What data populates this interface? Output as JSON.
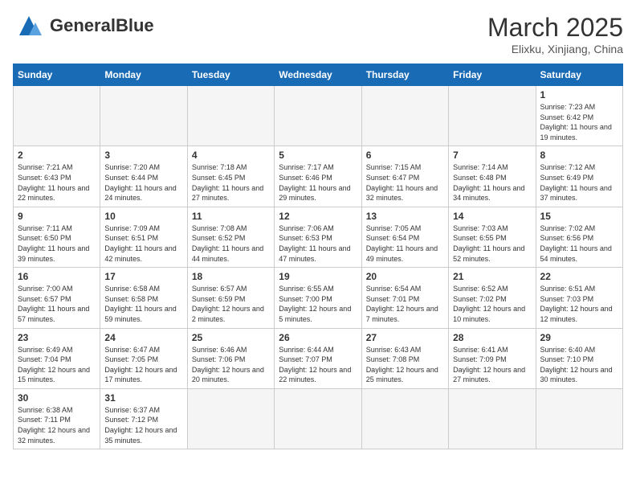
{
  "logo": {
    "text_normal": "General",
    "text_bold": "Blue"
  },
  "title": "March 2025",
  "location": "Elixku, Xinjiang, China",
  "days_of_week": [
    "Sunday",
    "Monday",
    "Tuesday",
    "Wednesday",
    "Thursday",
    "Friday",
    "Saturday"
  ],
  "weeks": [
    [
      {
        "num": "",
        "info": ""
      },
      {
        "num": "",
        "info": ""
      },
      {
        "num": "",
        "info": ""
      },
      {
        "num": "",
        "info": ""
      },
      {
        "num": "",
        "info": ""
      },
      {
        "num": "",
        "info": ""
      },
      {
        "num": "1",
        "info": "Sunrise: 7:23 AM\nSunset: 6:42 PM\nDaylight: 11 hours and 19 minutes."
      }
    ],
    [
      {
        "num": "2",
        "info": "Sunrise: 7:21 AM\nSunset: 6:43 PM\nDaylight: 11 hours and 22 minutes."
      },
      {
        "num": "3",
        "info": "Sunrise: 7:20 AM\nSunset: 6:44 PM\nDaylight: 11 hours and 24 minutes."
      },
      {
        "num": "4",
        "info": "Sunrise: 7:18 AM\nSunset: 6:45 PM\nDaylight: 11 hours and 27 minutes."
      },
      {
        "num": "5",
        "info": "Sunrise: 7:17 AM\nSunset: 6:46 PM\nDaylight: 11 hours and 29 minutes."
      },
      {
        "num": "6",
        "info": "Sunrise: 7:15 AM\nSunset: 6:47 PM\nDaylight: 11 hours and 32 minutes."
      },
      {
        "num": "7",
        "info": "Sunrise: 7:14 AM\nSunset: 6:48 PM\nDaylight: 11 hours and 34 minutes."
      },
      {
        "num": "8",
        "info": "Sunrise: 7:12 AM\nSunset: 6:49 PM\nDaylight: 11 hours and 37 minutes."
      }
    ],
    [
      {
        "num": "9",
        "info": "Sunrise: 7:11 AM\nSunset: 6:50 PM\nDaylight: 11 hours and 39 minutes."
      },
      {
        "num": "10",
        "info": "Sunrise: 7:09 AM\nSunset: 6:51 PM\nDaylight: 11 hours and 42 minutes."
      },
      {
        "num": "11",
        "info": "Sunrise: 7:08 AM\nSunset: 6:52 PM\nDaylight: 11 hours and 44 minutes."
      },
      {
        "num": "12",
        "info": "Sunrise: 7:06 AM\nSunset: 6:53 PM\nDaylight: 11 hours and 47 minutes."
      },
      {
        "num": "13",
        "info": "Sunrise: 7:05 AM\nSunset: 6:54 PM\nDaylight: 11 hours and 49 minutes."
      },
      {
        "num": "14",
        "info": "Sunrise: 7:03 AM\nSunset: 6:55 PM\nDaylight: 11 hours and 52 minutes."
      },
      {
        "num": "15",
        "info": "Sunrise: 7:02 AM\nSunset: 6:56 PM\nDaylight: 11 hours and 54 minutes."
      }
    ],
    [
      {
        "num": "16",
        "info": "Sunrise: 7:00 AM\nSunset: 6:57 PM\nDaylight: 11 hours and 57 minutes."
      },
      {
        "num": "17",
        "info": "Sunrise: 6:58 AM\nSunset: 6:58 PM\nDaylight: 11 hours and 59 minutes."
      },
      {
        "num": "18",
        "info": "Sunrise: 6:57 AM\nSunset: 6:59 PM\nDaylight: 12 hours and 2 minutes."
      },
      {
        "num": "19",
        "info": "Sunrise: 6:55 AM\nSunset: 7:00 PM\nDaylight: 12 hours and 5 minutes."
      },
      {
        "num": "20",
        "info": "Sunrise: 6:54 AM\nSunset: 7:01 PM\nDaylight: 12 hours and 7 minutes."
      },
      {
        "num": "21",
        "info": "Sunrise: 6:52 AM\nSunset: 7:02 PM\nDaylight: 12 hours and 10 minutes."
      },
      {
        "num": "22",
        "info": "Sunrise: 6:51 AM\nSunset: 7:03 PM\nDaylight: 12 hours and 12 minutes."
      }
    ],
    [
      {
        "num": "23",
        "info": "Sunrise: 6:49 AM\nSunset: 7:04 PM\nDaylight: 12 hours and 15 minutes."
      },
      {
        "num": "24",
        "info": "Sunrise: 6:47 AM\nSunset: 7:05 PM\nDaylight: 12 hours and 17 minutes."
      },
      {
        "num": "25",
        "info": "Sunrise: 6:46 AM\nSunset: 7:06 PM\nDaylight: 12 hours and 20 minutes."
      },
      {
        "num": "26",
        "info": "Sunrise: 6:44 AM\nSunset: 7:07 PM\nDaylight: 12 hours and 22 minutes."
      },
      {
        "num": "27",
        "info": "Sunrise: 6:43 AM\nSunset: 7:08 PM\nDaylight: 12 hours and 25 minutes."
      },
      {
        "num": "28",
        "info": "Sunrise: 6:41 AM\nSunset: 7:09 PM\nDaylight: 12 hours and 27 minutes."
      },
      {
        "num": "29",
        "info": "Sunrise: 6:40 AM\nSunset: 7:10 PM\nDaylight: 12 hours and 30 minutes."
      }
    ],
    [
      {
        "num": "30",
        "info": "Sunrise: 6:38 AM\nSunset: 7:11 PM\nDaylight: 12 hours and 32 minutes."
      },
      {
        "num": "31",
        "info": "Sunrise: 6:37 AM\nSunset: 7:12 PM\nDaylight: 12 hours and 35 minutes."
      },
      {
        "num": "",
        "info": ""
      },
      {
        "num": "",
        "info": ""
      },
      {
        "num": "",
        "info": ""
      },
      {
        "num": "",
        "info": ""
      },
      {
        "num": "",
        "info": ""
      }
    ]
  ]
}
